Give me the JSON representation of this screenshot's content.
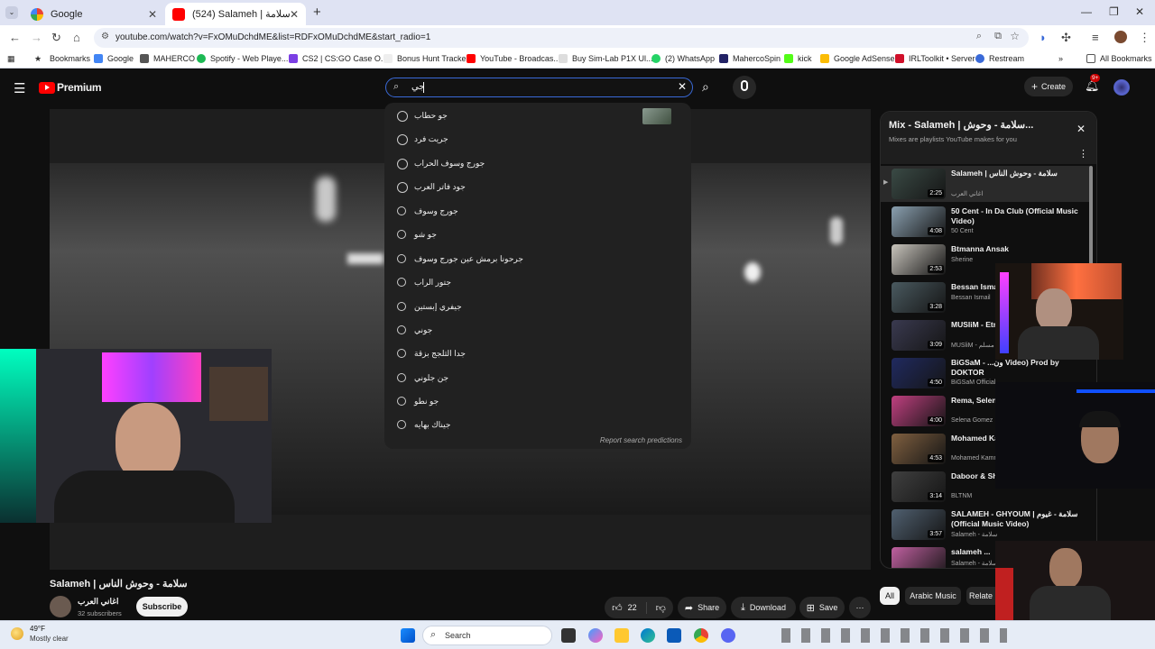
{
  "browser": {
    "tabs": [
      {
        "title": "Google",
        "active": false
      },
      {
        "title": "(524) Salameh | وحوش الناس - سلامة",
        "active": true
      }
    ],
    "url": "youtube.com/watch?v=FxOMuDchdME&list=RDFxOMuDchdME&start_radio=1",
    "bookmarks": [
      "Bookmarks",
      "Google",
      "MAHERCO",
      "Spotify - Web Playe...",
      "CS2 | CS:GO Case O...",
      "Bonus Hunt Tracker",
      "YouTube - Broadcas...",
      "Buy Sim-Lab P1X Ul...",
      "(2) WhatsApp",
      "MahercoSpin",
      "kick",
      "Google AdSense",
      "IRLToolkit • Server",
      "Restream"
    ],
    "all_bookmarks": "All Bookmarks"
  },
  "youtube": {
    "logo": "Premium",
    "search_value": "جي",
    "create_label": "Create",
    "notif_count": "9+",
    "suggestions": [
      {
        "text": "جو حطاب",
        "type": "history"
      },
      {
        "text": "جريت فرد",
        "type": "history"
      },
      {
        "text": "جورج وسوف الحراب",
        "type": "history"
      },
      {
        "text": "جود فاتر العرب",
        "type": "history"
      },
      {
        "text": "جورج وسوف",
        "type": "search"
      },
      {
        "text": "جو شو",
        "type": "search"
      },
      {
        "text": "جرحونا برمش عين جورج وسوف",
        "type": "search"
      },
      {
        "text": "جتور الراب",
        "type": "search"
      },
      {
        "text": "جيفري إبستين",
        "type": "search"
      },
      {
        "text": "جوني",
        "type": "search"
      },
      {
        "text": "جدا الثلجج بزقة",
        "type": "search"
      },
      {
        "text": "جن جلوني",
        "type": "search"
      },
      {
        "text": "جو نطو",
        "type": "search"
      },
      {
        "text": "جيناك بهايه",
        "type": "search"
      }
    ],
    "report_label": "Report search predictions",
    "video_title": "Salameh | سلامة - وحوش الناس",
    "channel_name": "اغاني العرب",
    "subscribers": "32 subscribers",
    "subscribe_label": "Subscribe",
    "likes": "22",
    "share_label": "Share",
    "download_label": "Download",
    "save_label": "Save",
    "mix": {
      "title": "Mix - Salameh | سلامة - وحوش...",
      "subtitle": "Mixes are playlists YouTube makes for you",
      "items": [
        {
          "title": "Salameh | سلامة - وحوش الناس",
          "channel": "اغاني العرب",
          "duration": "2:25",
          "color": "#3a4a45"
        },
        {
          "title": "50 Cent - In Da Club (Official Music Video)",
          "channel": "50 Cent",
          "duration": "4:08",
          "color": "#8aa0b0"
        },
        {
          "title": "Btmanna Ansak",
          "channel": "Sherine",
          "duration": "2:53",
          "color": "#c8c4bc"
        },
        {
          "title": "Bessan Ismai... (Official",
          "channel": "Bessan Ismail",
          "duration": "3:28",
          "color": "#4a5a60"
        },
        {
          "title": "MUSliM - Etn... Video - 2021",
          "channel": "MUSliM - مسلم",
          "duration": "3:09",
          "color": "#3a3a50"
        },
        {
          "title": "BiGSaM - ...ون Video) Prod by DOKTOR",
          "channel": "BiGSaM Official",
          "duration": "4:50",
          "color": "#202a60"
        },
        {
          "title": "Rema, Selena... Down (Official",
          "channel": "Selena Gomez",
          "duration": "4:00",
          "color": "#c04080"
        },
        {
          "title": "Mohamed Kam... - Ana Mesh Sa...",
          "channel": "Mohamed Kamn",
          "duration": "4:53",
          "color": "#806040"
        },
        {
          "title": "Daboor & Shal... (Prod. Al Nather)",
          "channel": "BLTNM",
          "duration": "3:14",
          "color": "#404040"
        },
        {
          "title": "SALAMEH - GHYOUM | سلامة - غيوم (Official Music Video)",
          "channel": "Salameh - سلامة",
          "duration": "3:57",
          "color": "#506070"
        },
        {
          "title": "salameh ...",
          "channel": "Salameh - سلامة",
          "duration": "3:21",
          "color": "#c060a0"
        }
      ]
    },
    "chips": [
      "All",
      "Arabic Music",
      "Relate"
    ]
  },
  "taskbar": {
    "weather_temp": "49°F",
    "weather_desc": "Mostly clear",
    "search_label": "Search"
  }
}
